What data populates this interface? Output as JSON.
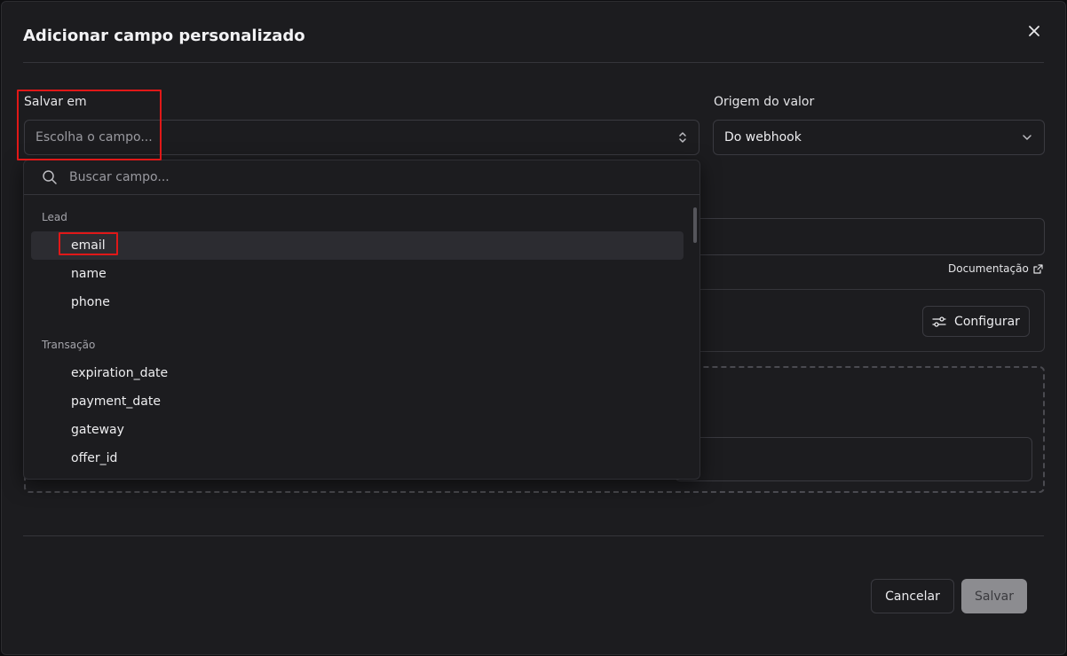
{
  "dialog": {
    "title": "Adicionar campo personalizado"
  },
  "save_in": {
    "label": "Salvar em",
    "placeholder": "Escolha o campo..."
  },
  "value_origin": {
    "label": "Origem do valor",
    "selected": "Do webhook"
  },
  "documentation_link": "Documentação",
  "configure_button": "Configurar",
  "dropdown": {
    "search_placeholder": "Buscar campo...",
    "groups": [
      {
        "label": "Lead",
        "items": [
          "email",
          "name",
          "phone"
        ]
      },
      {
        "label": "Transação",
        "items": [
          "expiration_date",
          "payment_date",
          "gateway",
          "offer_id"
        ]
      }
    ],
    "active_item": "email"
  },
  "footer": {
    "cancel": "Cancelar",
    "save": "Salvar"
  },
  "colors": {
    "background": "#1c1c1f",
    "highlight": "#e01818",
    "save_disabled": "#8c8c90"
  }
}
